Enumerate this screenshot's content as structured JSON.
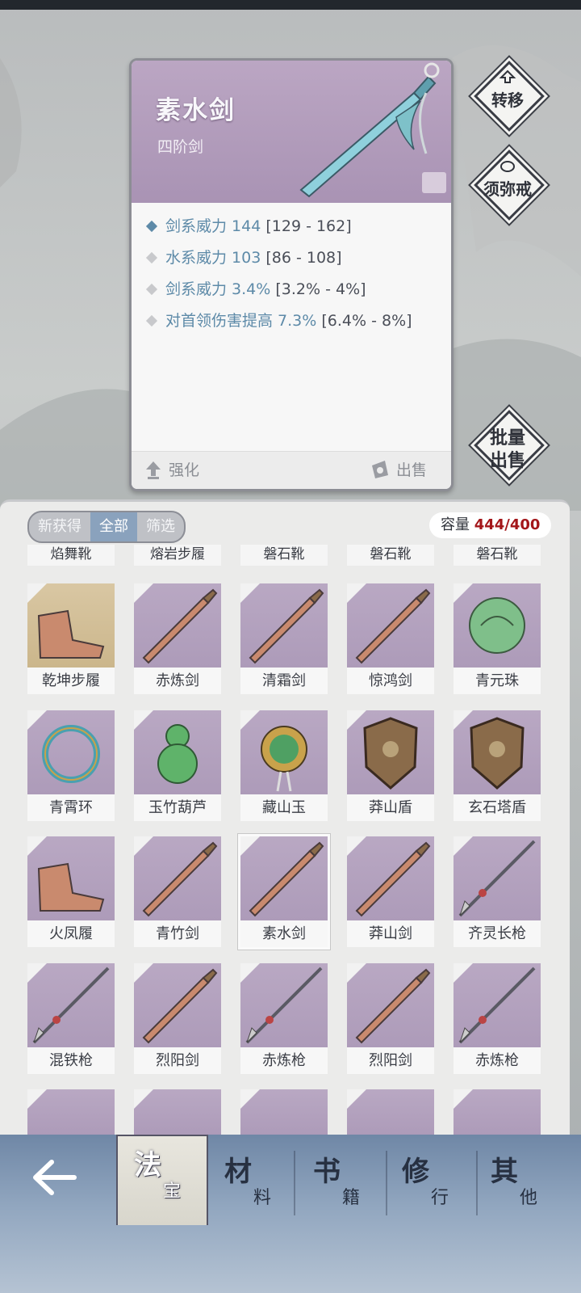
{
  "detail": {
    "title": "素水剑",
    "subtitle": "四阶剑",
    "stats": [
      {
        "label": "剑系威力 144",
        "range": "[129 - 162]",
        "color": "#5d8aa8"
      },
      {
        "label": "水系威力 103",
        "range": "[86 - 108]",
        "color": "#c8c9cc"
      },
      {
        "label": "剑系威力 3.4%",
        "range": "[3.2% - 4%]",
        "color": "#c8c9cc"
      },
      {
        "label": "对首领伤害提高 7.3%",
        "range": "[6.4% - 8%]",
        "color": "#c8c9cc"
      }
    ],
    "enhance_label": "强化",
    "sell_label": "出售"
  },
  "side_buttons": {
    "transfer": "转移",
    "sumeru": "须弥戒",
    "bulk_sell_line1": "批量",
    "bulk_sell_line2": "出售"
  },
  "filters": {
    "new": "新获得",
    "all": "全部",
    "filter": "筛选"
  },
  "capacity": {
    "label": "容量",
    "value": "444/400"
  },
  "top_row": [
    "焰舞靴",
    "熔岩步履",
    "磐石靴",
    "磐石靴",
    "磐石靴"
  ],
  "rows": [
    [
      {
        "name": "乾坤步履",
        "icon": "boots-icon",
        "bg": "gold"
      },
      {
        "name": "赤炼剑",
        "icon": "sword-icon"
      },
      {
        "name": "清霜剑",
        "icon": "sword-icon"
      },
      {
        "name": "惊鸿剑",
        "icon": "sword-icon"
      },
      {
        "name": "青元珠",
        "icon": "orb-icon"
      }
    ],
    [
      {
        "name": "青霄环",
        "icon": "ring-icon"
      },
      {
        "name": "玉竹葫芦",
        "icon": "gourd-icon"
      },
      {
        "name": "藏山玉",
        "icon": "jade-icon"
      },
      {
        "name": "莽山盾",
        "icon": "shield-icon"
      },
      {
        "name": "玄石塔盾",
        "icon": "shield-icon"
      }
    ],
    [
      {
        "name": "火凤履",
        "icon": "boots-icon"
      },
      {
        "name": "青竹剑",
        "icon": "sword-icon"
      },
      {
        "name": "素水剑",
        "icon": "sword-icon",
        "selected": true
      },
      {
        "name": "莽山剑",
        "icon": "sword-icon"
      },
      {
        "name": "齐灵长枪",
        "icon": "spear-icon"
      }
    ],
    [
      {
        "name": "混铁枪",
        "icon": "spear-icon"
      },
      {
        "name": "烈阳剑",
        "icon": "sword-icon"
      },
      {
        "name": "赤炼枪",
        "icon": "spear-icon"
      },
      {
        "name": "烈阳剑",
        "icon": "sword-icon"
      },
      {
        "name": "赤炼枪",
        "icon": "spear-icon"
      }
    ]
  ],
  "nav": {
    "tabs": [
      {
        "big": "法",
        "small": "宝"
      },
      {
        "big": "材",
        "small": "料"
      },
      {
        "big": "书",
        "small": "籍"
      },
      {
        "big": "修",
        "small": "行"
      },
      {
        "big": "其",
        "small": "他"
      }
    ]
  }
}
